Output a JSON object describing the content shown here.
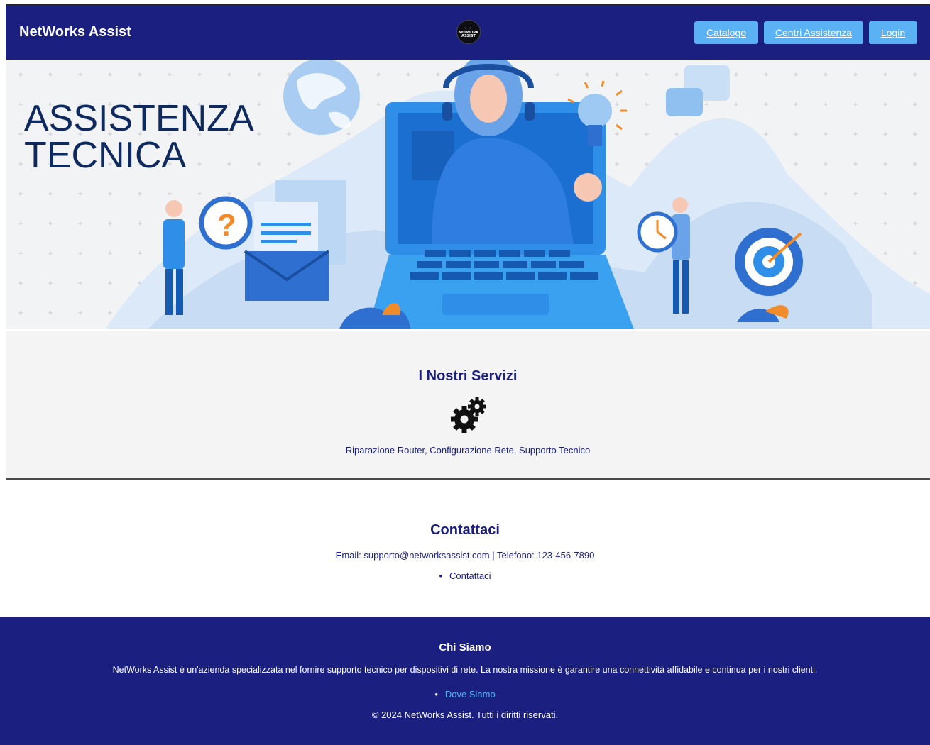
{
  "header": {
    "brand": "NetWorks Assist",
    "logo_text": "NETWORK ASSIST",
    "nav": {
      "catalogo": "Catalogo",
      "centri": "Centri Assistenza",
      "login": "Login"
    }
  },
  "hero": {
    "title_line1": "ASSISTENZA",
    "title_line2": "TECNICA",
    "icon": "tech-support-illustration"
  },
  "services": {
    "title": "I Nostri Servizi",
    "icon": "gears-icon",
    "description": "Riparazione Router, Configurazione Rete, Supporto Tecnico"
  },
  "contact": {
    "title": "Contattaci",
    "info": "Email: supporto@networksassist.com | Telefono: 123-456-7890",
    "link": "Contattaci"
  },
  "footer": {
    "title": "Chi Siamo",
    "about": "NetWorks Assist è un'azienda specializzata nel fornire supporto tecnico per dispositivi di rete. La nostra missione è garantire una connettività affidabile e continua per i nostri clienti.",
    "where_link": "Dove Siamo",
    "copyright": "© 2024 NetWorks Assist. Tutti i diritti riservati."
  },
  "colors": {
    "navy": "#1b2080",
    "button_blue": "#5ab2f5",
    "hero_bg": "#f2f3f5",
    "hero_blue": "#2e8ee8",
    "title_navy": "#0f2a5e"
  }
}
